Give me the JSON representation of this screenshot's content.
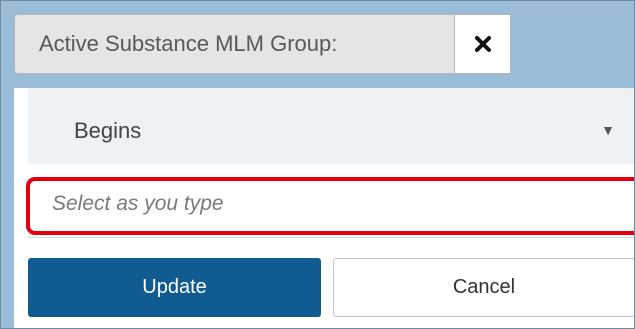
{
  "filter": {
    "label": "Active Substance MLM Group:",
    "remove_icon": "close-icon"
  },
  "operator": {
    "selected": "Begins",
    "chevron": "▼"
  },
  "search": {
    "placeholder": "Select as you type",
    "value": ""
  },
  "actions": {
    "update_label": "Update",
    "cancel_label": "Cancel"
  },
  "colors": {
    "primary": "#0f5b92",
    "highlight": "#e3000f",
    "backdrop": "#9bbcd6"
  }
}
